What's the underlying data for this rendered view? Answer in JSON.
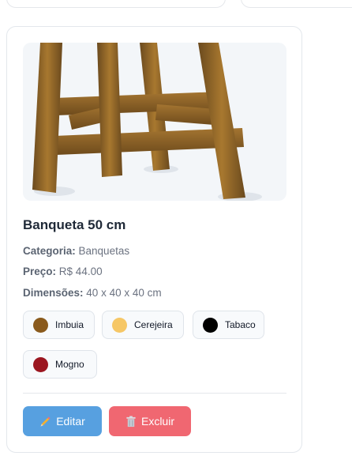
{
  "product": {
    "title": "Banqueta 50 cm",
    "category_label": "Categoria:",
    "category_value": "Banquetas",
    "price_label": "Preço:",
    "price_value": "R$ 44.00",
    "dimensions_label": "Dimensões:",
    "dimensions_value": "40 x 40 x 40 cm",
    "image_icon": "wooden-stool-image",
    "colors": [
      {
        "name": "Imbuia",
        "hex": "#8a5a1c"
      },
      {
        "name": "Cerejeira",
        "hex": "#f6c766"
      },
      {
        "name": "Tabaco",
        "hex": "#000000"
      },
      {
        "name": "Mogno",
        "hex": "#9b1620"
      }
    ]
  },
  "actions": {
    "edit_label": "Editar",
    "edit_icon": "pencil-icon",
    "edit_color": "#57a0e0",
    "delete_label": "Excluir",
    "delete_icon": "trash-icon",
    "delete_color": "#f06771"
  }
}
